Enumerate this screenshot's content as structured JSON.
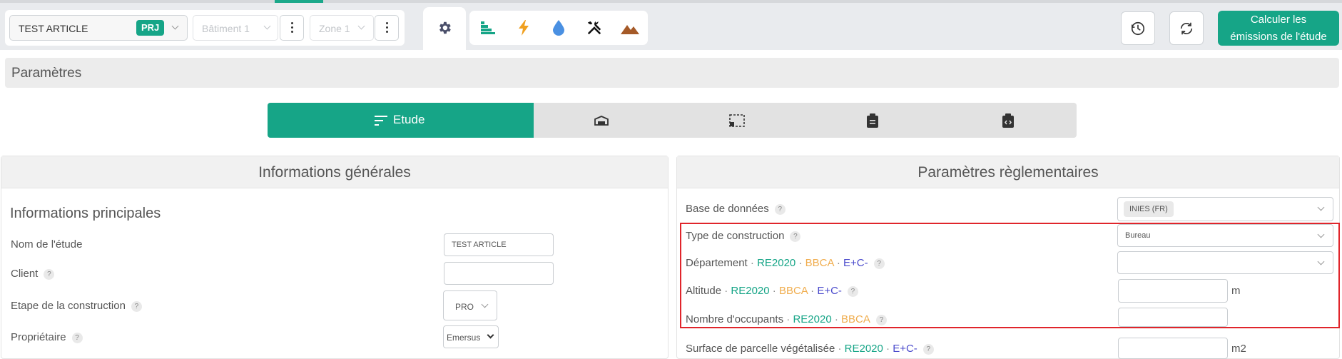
{
  "toolbar": {
    "project_select": "TEST ARTICLE",
    "project_badge": "PRJ",
    "building_select": "Bâtiment 1",
    "zone_select": "Zone 1",
    "calculate_button": [
      "Calculer les",
      "émissions de l'étude"
    ]
  },
  "colors": {
    "primary": "#16a587",
    "re2020": "#16a587",
    "bbca": "#f0ad4e",
    "ec": "#4b4bcc",
    "highlight": "#e0252b"
  },
  "icons": [
    "gear-icon",
    "stairs-icon",
    "lightning-icon",
    "water-drop-icon",
    "tools-icon",
    "mountains-icon",
    "history-icon",
    "refresh-icon"
  ],
  "page_title": "Paramètres",
  "tabs": [
    {
      "label": "Etude",
      "icon": "sort-lines-icon",
      "active": true
    },
    {
      "label": "",
      "icon": "box-icon",
      "active": false
    },
    {
      "label": "",
      "icon": "dashed-area-icon",
      "active": false
    },
    {
      "label": "",
      "icon": "clipboard-icon",
      "active": false
    },
    {
      "label": "",
      "icon": "code-clipboard-icon",
      "active": false
    }
  ],
  "general": {
    "title": "Informations générales",
    "section": "Informations principales",
    "fields": {
      "study_name": {
        "label": "Nom de l'étude",
        "value": "TEST ARTICLE"
      },
      "client": {
        "label": "Client",
        "value": ""
      },
      "stage": {
        "label": "Etape de la construction",
        "value": "PRO"
      },
      "owner": {
        "label": "Propriétaire",
        "value": "Emersus"
      }
    }
  },
  "regulatory": {
    "title": "Paramètres règlementaires",
    "tags": {
      "re2020": "RE2020",
      "bbca": "BBCA",
      "ec": "E+C-",
      "sep": "·"
    },
    "fields": {
      "database": {
        "label": "Base de données",
        "value": "INIES (FR)"
      },
      "construction_type": {
        "label": "Type de construction",
        "value": "Bureau"
      },
      "department": {
        "label": "Département",
        "value": ""
      },
      "altitude": {
        "label": "Altitude",
        "value": "",
        "unit": "m"
      },
      "occupants": {
        "label": "Nombre d'occupants",
        "value": ""
      },
      "green_area": {
        "label": "Surface de parcelle végétalisée",
        "value": "",
        "unit": "m2"
      }
    }
  }
}
